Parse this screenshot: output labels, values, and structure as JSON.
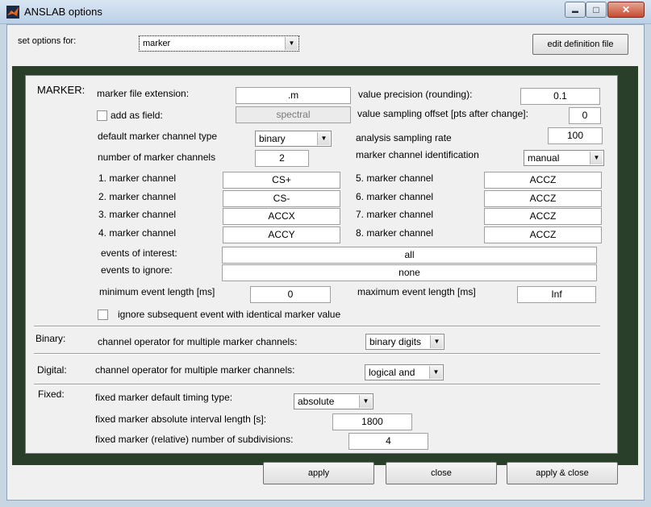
{
  "window": {
    "title": "ANSLAB options",
    "min_glyph": "▬",
    "max_glyph": "□",
    "close_glyph": "✕"
  },
  "header": {
    "set_options_label": "set options for:",
    "set_options_value": "marker",
    "edit_definition_label": "edit definition file"
  },
  "marker": {
    "section_label": "MARKER:",
    "file_ext_label": "marker file extension:",
    "file_ext_value": ".m",
    "precision_label": "value precision (rounding):",
    "precision_value": "0.1",
    "add_field_label": "add as field:",
    "add_field_value": "spectral",
    "offset_label": "value sampling offset [pts after change]:",
    "offset_value": "0",
    "channel_type_label": "default marker channel type",
    "channel_type_value": "binary",
    "sampling_rate_label": "analysis sampling rate",
    "sampling_rate_value": "100",
    "num_channels_label": "number of marker channels",
    "num_channels_value": "2",
    "identification_label": "marker channel identification",
    "identification_value": "manual",
    "channels": [
      {
        "label": "1. marker channel",
        "value": "CS+"
      },
      {
        "label": "2. marker channel",
        "value": "CS-"
      },
      {
        "label": "3. marker channel",
        "value": "ACCX"
      },
      {
        "label": "4. marker channel",
        "value": "ACCY"
      },
      {
        "label": "5. marker channel",
        "value": "ACCZ"
      },
      {
        "label": "6. marker channel",
        "value": "ACCZ"
      },
      {
        "label": "7. marker channel",
        "value": "ACCZ"
      },
      {
        "label": "8. marker channel",
        "value": "ACCZ"
      }
    ],
    "events_interest_label": "events of interest:",
    "events_interest_value": "all",
    "events_ignore_label": "events to ignore:",
    "events_ignore_value": "none",
    "min_len_label": "minimum event length [ms]",
    "min_len_value": "0",
    "max_len_label": "maximum event length [ms]",
    "max_len_value": "Inf",
    "ignore_subsequent_label": "ignore subsequent event with identical marker value"
  },
  "binary": {
    "section_label": "Binary:",
    "operator_label": "channel operator for multiple marker channels:",
    "operator_value": "binary digits"
  },
  "digital": {
    "section_label": "Digital:",
    "operator_label": "channel operator for multiple marker channels:",
    "operator_value": "logical and"
  },
  "fixed": {
    "section_label": "Fixed:",
    "timing_label": "fixed marker default timing type:",
    "timing_value": "absolute",
    "interval_label": "fixed marker absolute interval length [s]:",
    "interval_value": "1800",
    "subdiv_label": "fixed marker (relative) number of subdivisions:",
    "subdiv_value": "4"
  },
  "footer": {
    "apply_label": "apply",
    "close_label": "close",
    "apply_close_label": "apply & close"
  },
  "dropdown_arrow": "▼",
  "icons": {
    "app": "matlab-logo-icon",
    "dropdown": "chevron-down-icon"
  }
}
